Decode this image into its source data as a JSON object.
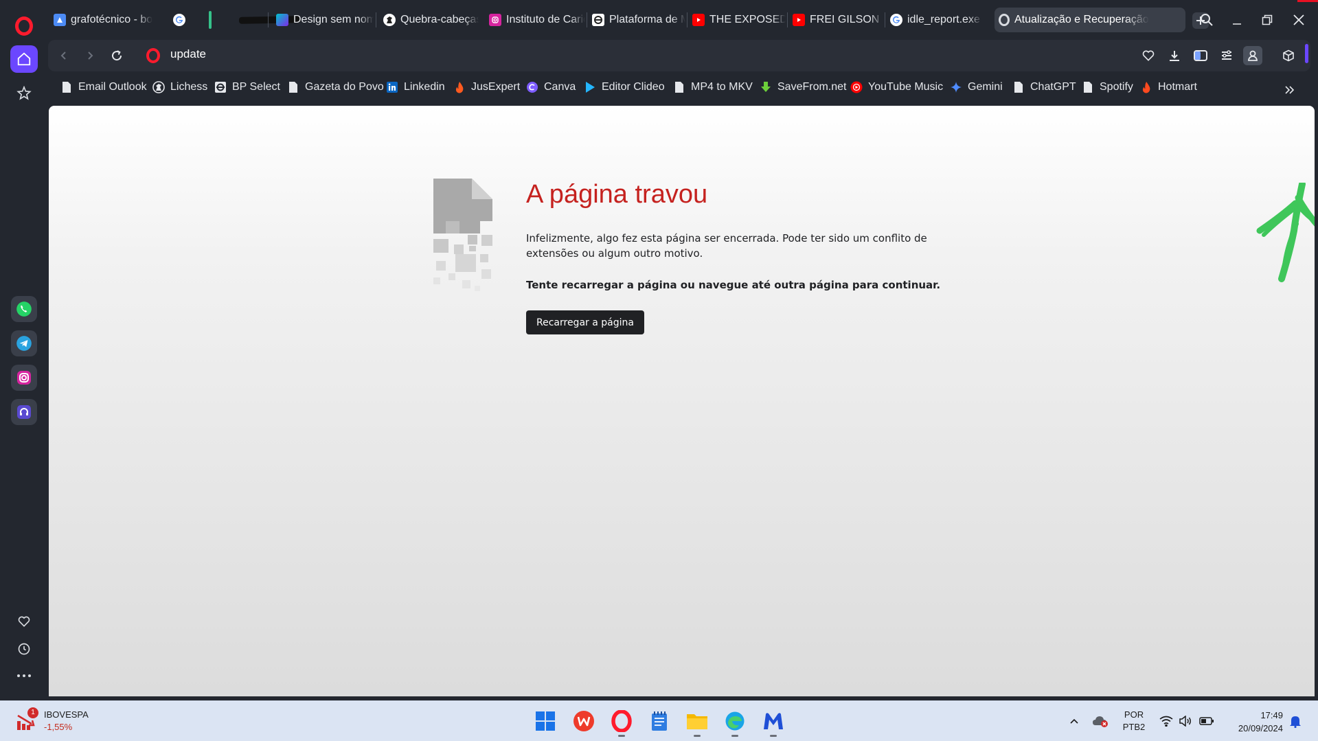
{
  "tabs": [
    {
      "label": "grafotécnico - bo",
      "icon": "document-icon"
    },
    {
      "label": "",
      "icon": "google-icon",
      "redacted": true
    },
    {
      "label": "Design sem nom",
      "icon": "canva-design-icon"
    },
    {
      "label": "Quebra-cabeças",
      "icon": "lichess-icon"
    },
    {
      "label": "Instituto de Caric",
      "icon": "instagram-icon"
    },
    {
      "label": "Plataforma de M",
      "icon": "platform-icon"
    },
    {
      "label": "THE EXPOSED BI",
      "icon": "youtube-icon"
    },
    {
      "label": "FREI GILSON - In",
      "icon": "youtube-icon"
    },
    {
      "label": "idle_report.exe n",
      "icon": "google-icon"
    },
    {
      "label": "Atualização e Recuperação",
      "icon": "opera-icon",
      "active": true
    }
  ],
  "address_bar": {
    "url": "update"
  },
  "bookmarks": [
    {
      "label": "Email Outlook",
      "icon": "document-icon"
    },
    {
      "label": "Lichess",
      "icon": "lichess-icon"
    },
    {
      "label": "BP Select",
      "icon": "platform-icon"
    },
    {
      "label": "Gazeta do Povo",
      "icon": "document-icon"
    },
    {
      "label": "Linkedin",
      "icon": "linkedin-icon"
    },
    {
      "label": "JusExpert",
      "icon": "flame-icon"
    },
    {
      "label": "Canva",
      "icon": "canva-icon"
    },
    {
      "label": "Editor Clideo",
      "icon": "play-icon"
    },
    {
      "label": "MP4 to MKV",
      "icon": "document-icon"
    },
    {
      "label": "SaveFrom.net",
      "icon": "download-arrow-icon"
    },
    {
      "label": "YouTube Music",
      "icon": "youtube-music-icon"
    },
    {
      "label": "Gemini",
      "icon": "gemini-sparkle-icon"
    },
    {
      "label": "ChatGPT",
      "icon": "document-icon"
    },
    {
      "label": "Spotify",
      "icon": "document-icon"
    },
    {
      "label": "Hotmart",
      "icon": "flame-icon"
    }
  ],
  "crash_page": {
    "title": "A página travou",
    "description": "Infelizmente, algo fez esta página ser encerrada. Pode ter sido um conflito de extensões ou algum outro motivo.",
    "instruction": "Tente recarregar a página ou navegue até outra página para continuar.",
    "reload_label": "Recarregar a página"
  },
  "taskbar": {
    "widget": {
      "name": "IBOVESPA",
      "value": "-1,55%",
      "badge": "1"
    },
    "language": {
      "line1": "POR",
      "line2": "PTB2"
    },
    "clock": {
      "time": "17:49",
      "date": "20/09/2024"
    }
  },
  "colors": {
    "opera_red": "#ff1b2d",
    "sidebar_accent": "#6b47ff",
    "crash_title": "#c5221f",
    "button_dark": "#202124",
    "taskbar_bg": "#dbe4f3",
    "negative_value": "#c42b1c"
  }
}
